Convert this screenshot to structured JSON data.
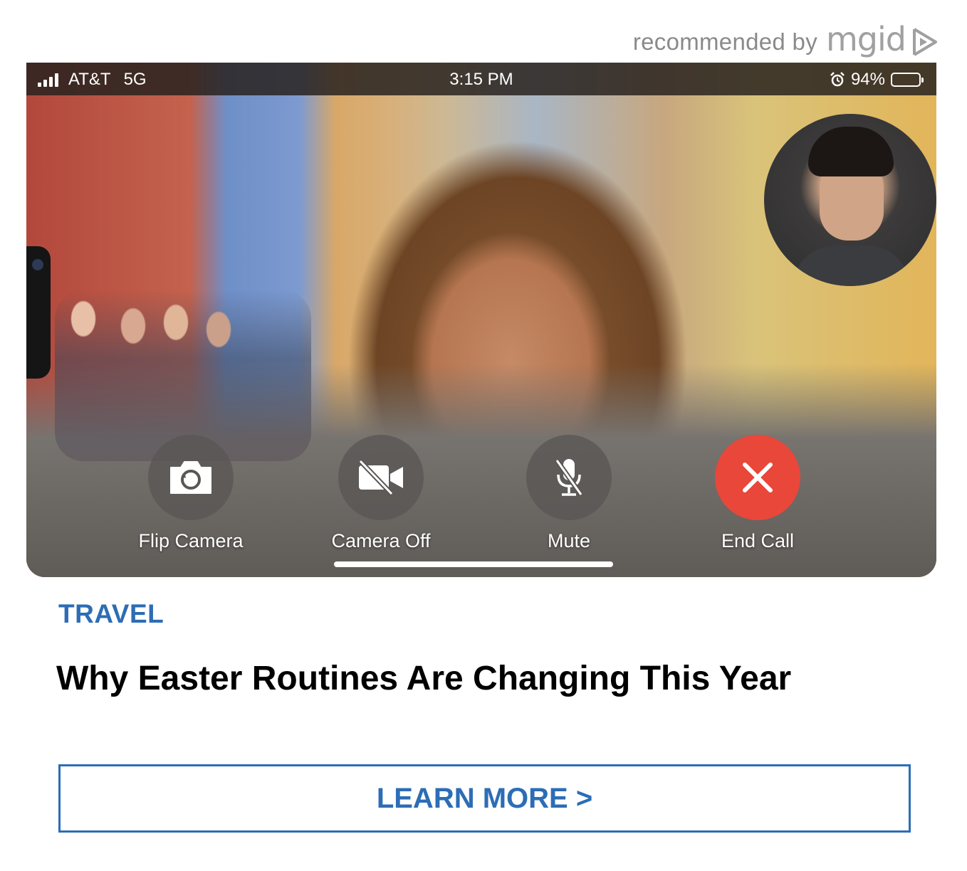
{
  "header": {
    "recommended_text": "recommended by",
    "brand": "mgid",
    "brand_icon": "play-triangle-icon"
  },
  "image": {
    "status_bar": {
      "carrier": "AT&T",
      "network": "5G",
      "time": "3:15 PM",
      "battery": "94%",
      "battery_level": 0.94,
      "alarm_icon": "alarm-clock-icon"
    },
    "controls": [
      {
        "label": "Flip Camera",
        "icon": "camera-flip-icon"
      },
      {
        "label": "Camera Off",
        "icon": "video-off-icon"
      },
      {
        "label": "Mute",
        "icon": "microphone-off-icon"
      },
      {
        "label": "End Call",
        "icon": "close-icon"
      }
    ],
    "colors": {
      "end_call": "#e8473a",
      "control_bg": "#5a5654"
    }
  },
  "article": {
    "category": "TRAVEL",
    "headline": "Why Easter Routines Are Changing This Year"
  },
  "cta": {
    "label": "LEARN MORE >"
  },
  "colors": {
    "accent": "#2c6db5",
    "header_gray": "#8a8a8a"
  }
}
